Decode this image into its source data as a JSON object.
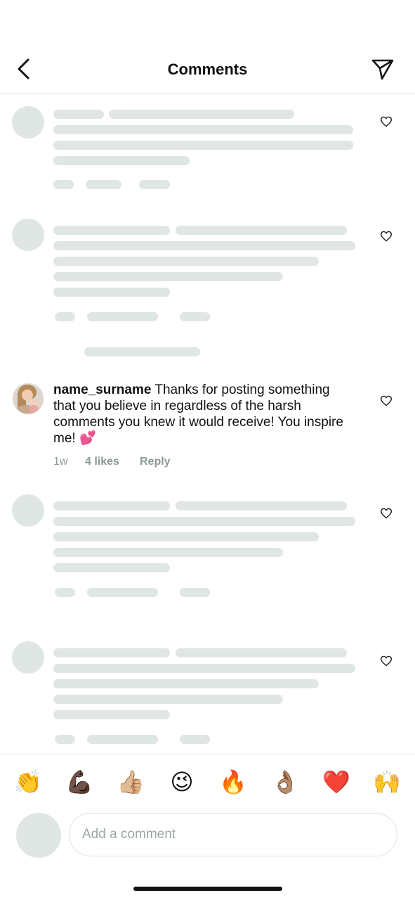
{
  "header": {
    "title": "Comments",
    "back_icon": "chevron-left-icon",
    "share_icon": "paper-plane-icon"
  },
  "comment": {
    "username": "name_surname",
    "text": "Thanks for posting something that you believe in regardless of the harsh comments you knew it would receive! You inspire me!",
    "emoji": "💕",
    "time": "1w",
    "likes": "4 likes",
    "reply": "Reply"
  },
  "emoji_bar": [
    "👏",
    "💪🏿",
    "👍🏼",
    "😉",
    "🔥",
    "👌🏽",
    "❤️",
    "🙌"
  ],
  "composer": {
    "placeholder": "Add a comment"
  },
  "colors": {
    "skeleton": "#dfe6e3",
    "meta_text": "#8a9a95",
    "placeholder_text": "#9aa8a3"
  }
}
